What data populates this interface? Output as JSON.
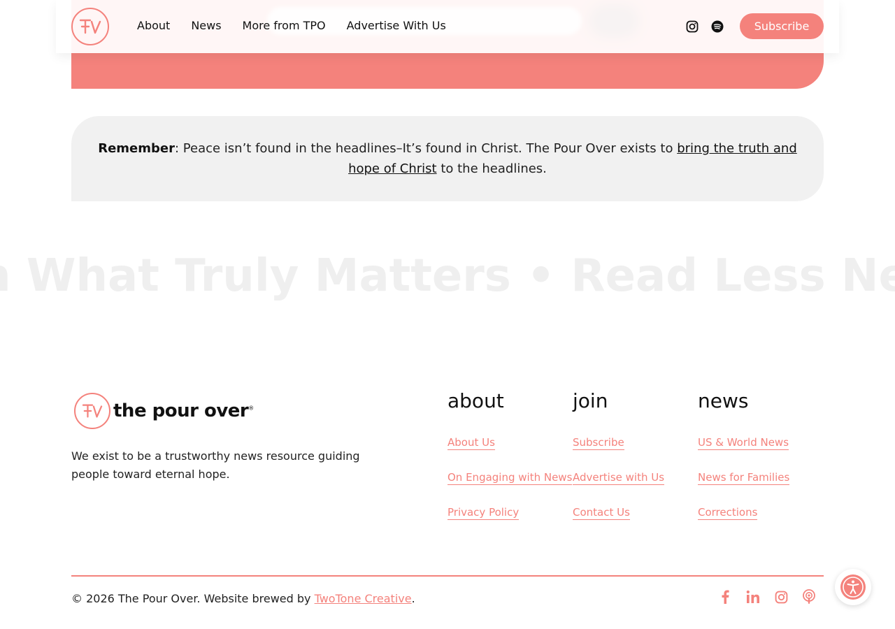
{
  "brand": {
    "accent": "#f4827c",
    "name": "the pour over",
    "mark": "®",
    "tagline": "We exist to be a trustworthy news resource guiding people toward eternal hope."
  },
  "header": {
    "nav": [
      "About",
      "News",
      "More from TPO",
      "Advertise With Us"
    ],
    "icons": [
      "instagram-icon",
      "spotify-icon"
    ],
    "subscribe_label": "Subscribe"
  },
  "remember": {
    "label": "Remember",
    "text_before": ": Peace isn’t found in the headlines–It’s found in Christ. The Pour Over exists to ",
    "link": "bring the truth and hope of Christ",
    "text_after": " to the headlines."
  },
  "marquee": {
    "text": "n What Truly Matters • Read Less News •"
  },
  "footer": {
    "columns": [
      {
        "title": "about",
        "links": [
          "About Us",
          "On Engaging with News",
          "Privacy Policy"
        ]
      },
      {
        "title": "join",
        "links": [
          "Subscribe",
          "Advertise with Us",
          "Contact Us"
        ]
      },
      {
        "title": "news",
        "links": [
          "US & World News",
          "News for Families",
          "Corrections"
        ]
      }
    ],
    "copyright": "© 2026 The Pour Over. Website brewed by ",
    "credit_link": "TwoTone Creative",
    "credit_end": ".",
    "social_icons": [
      "facebook-icon",
      "linkedin-icon",
      "instagram-icon",
      "podcast-icon"
    ]
  }
}
